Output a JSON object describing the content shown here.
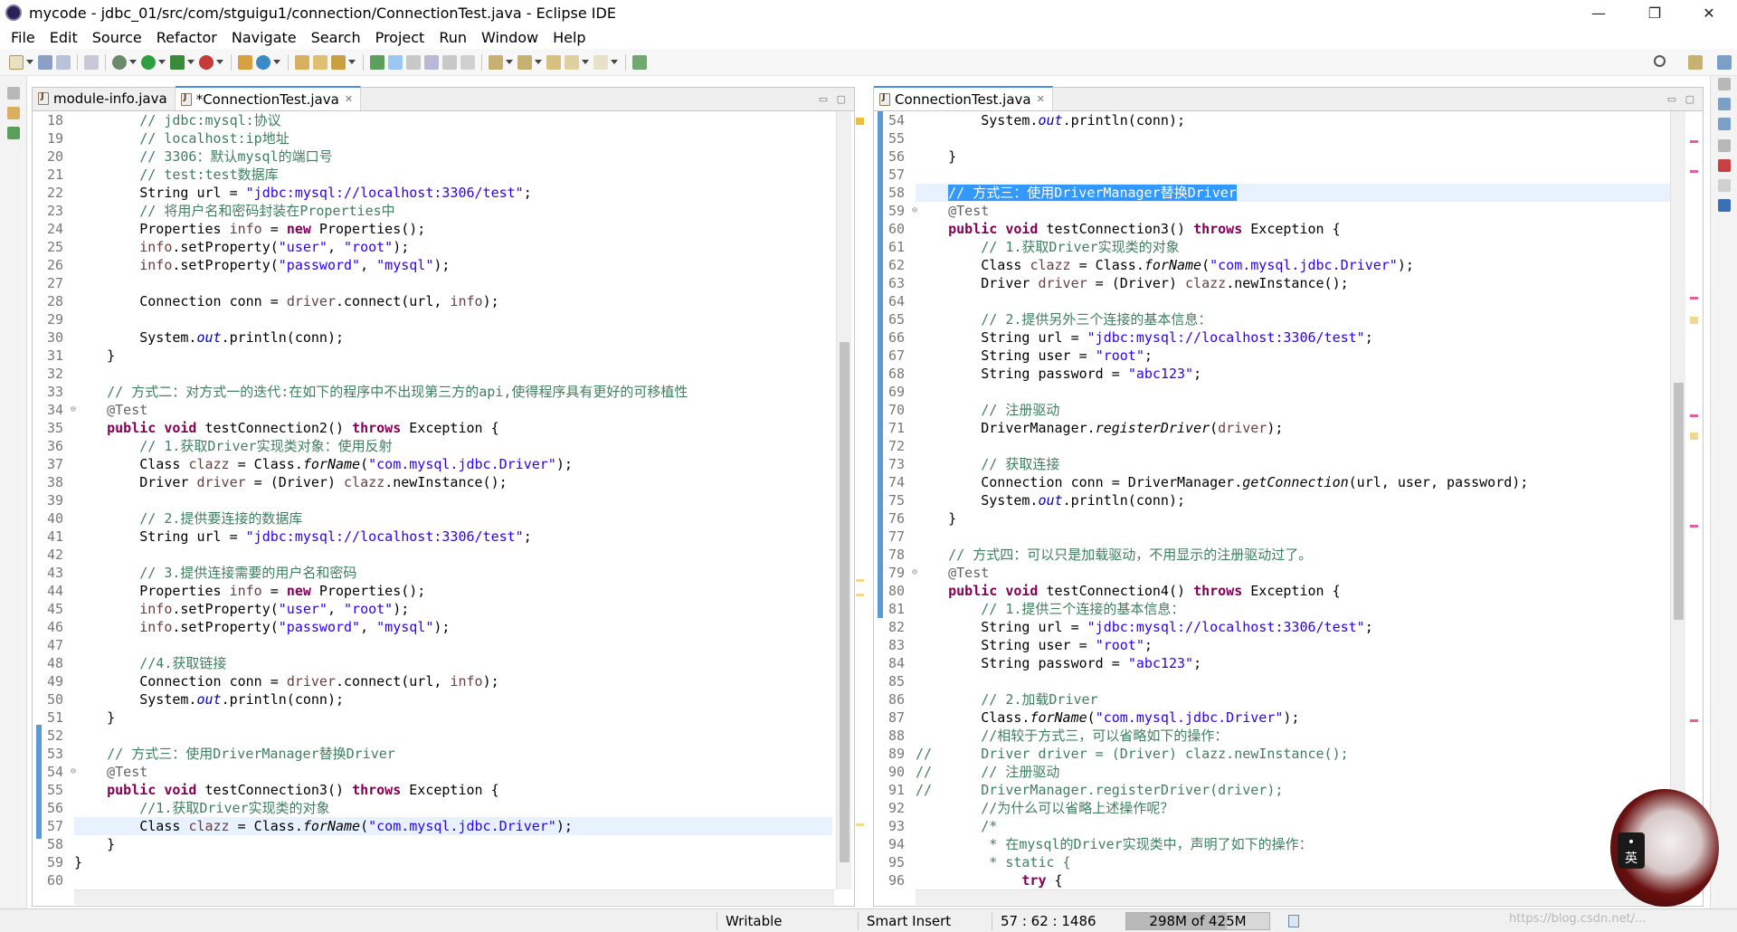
{
  "window": {
    "title": "mycode - jdbc_01/src/com/stguigu1/connection/ConnectionTest.java - Eclipse IDE",
    "controls": [
      "—",
      "❐",
      "✕"
    ]
  },
  "menu": [
    "File",
    "Edit",
    "Source",
    "Refactor",
    "Navigate",
    "Search",
    "Project",
    "Run",
    "Window",
    "Help"
  ],
  "left_editor": {
    "tabs": [
      {
        "label": "module-info.java",
        "active": false
      },
      {
        "label": "*ConnectionTest.java",
        "active": true
      }
    ],
    "line_numbers": [
      "18",
      "19",
      "20",
      "21",
      "22",
      "23",
      "24",
      "25",
      "26",
      "27",
      "28",
      "29",
      "30",
      "31",
      "32",
      "33",
      "34",
      "35",
      "36",
      "37",
      "38",
      "39",
      "40",
      "41",
      "42",
      "43",
      "44",
      "45",
      "46",
      "47",
      "48",
      "49",
      "50",
      "51",
      "52",
      "53",
      "54",
      "55",
      "56",
      "57",
      "58",
      "59",
      "60"
    ],
    "lines": [
      "        // jdbc:mysql:协议",
      "        // localhost:ip地址",
      "        // 3306：默认mysql的端口号",
      "        // test:test数据库",
      "        String url = \"jdbc:mysql://localhost:3306/test\";",
      "        // 将用户名和密码封装在Properties中",
      "        Properties info = new Properties();",
      "        info.setProperty(\"user\", \"root\");",
      "        info.setProperty(\"password\", \"mysql\");",
      "",
      "        Connection conn = driver.connect(url, info);",
      "",
      "        System.out.println(conn);",
      "    }",
      "",
      "    // 方式二：对方式一的迭代:在如下的程序中不出现第三方的api,使得程序具有更好的可移植性",
      "    @Test",
      "    public void testConnection2() throws Exception {",
      "        // 1.获取Driver实现类对象：使用反射",
      "        Class clazz = Class.forName(\"com.mysql.jdbc.Driver\");",
      "        Driver driver = (Driver) clazz.newInstance();",
      "",
      "        // 2.提供要连接的数据库",
      "        String url = \"jdbc:mysql://localhost:3306/test\";",
      "",
      "        // 3.提供连接需要的用户名和密码",
      "        Properties info = new Properties();",
      "        info.setProperty(\"user\", \"root\");",
      "        info.setProperty(\"password\", \"mysql\");",
      "",
      "        //4.获取链接",
      "        Connection conn = driver.connect(url, info);",
      "        System.out.println(conn);",
      "    }",
      "",
      "    // 方式三：使用DriverManager替换Driver",
      "    @Test",
      "    public void testConnection3() throws Exception {",
      "        //1.获取Driver实现类的对象",
      "        Class clazz = Class.forName(\"com.mysql.jdbc.Driver\");",
      "    }",
      "}",
      ""
    ]
  },
  "right_editor": {
    "tabs": [
      {
        "label": "ConnectionTest.java",
        "active": true
      }
    ],
    "line_numbers": [
      "54",
      "55",
      "56",
      "57",
      "58",
      "59",
      "60",
      "61",
      "62",
      "63",
      "64",
      "65",
      "66",
      "67",
      "68",
      "69",
      "70",
      "71",
      "72",
      "73",
      "74",
      "75",
      "76",
      "77",
      "78",
      "79",
      "80",
      "81",
      "82",
      "83",
      "84",
      "85",
      "86",
      "87",
      "88",
      "89",
      "90",
      "91",
      "92",
      "93",
      "94",
      "95",
      "96"
    ],
    "lines": [
      "        System.out.println(conn);",
      "",
      "    }",
      "",
      "    // 方式三：使用DriverManager替换Driver",
      "    @Test",
      "    public void testConnection3() throws Exception {",
      "        // 1.获取Driver实现类的对象",
      "        Class clazz = Class.forName(\"com.mysql.jdbc.Driver\");",
      "        Driver driver = (Driver) clazz.newInstance();",
      "",
      "        // 2.提供另外三个连接的基本信息：",
      "        String url = \"jdbc:mysql://localhost:3306/test\";",
      "        String user = \"root\";",
      "        String password = \"abc123\";",
      "",
      "        // 注册驱动",
      "        DriverManager.registerDriver(driver);",
      "",
      "        // 获取连接",
      "        Connection conn = DriverManager.getConnection(url, user, password);",
      "        System.out.println(conn);",
      "    }",
      "",
      "    // 方式四：可以只是加载驱动，不用显示的注册驱动过了。",
      "    @Test",
      "    public void testConnection4() throws Exception {",
      "        // 1.提供三个连接的基本信息：",
      "        String url = \"jdbc:mysql://localhost:3306/test\";",
      "        String user = \"root\";",
      "        String password = \"abc123\";",
      "",
      "        // 2.加载Driver",
      "        Class.forName(\"com.mysql.jdbc.Driver\");",
      "        //相较于方式三，可以省略如下的操作：",
      "//      Driver driver = (Driver) clazz.newInstance();",
      "//      // 注册驱动",
      "//      DriverManager.registerDriver(driver);",
      "        //为什么可以省略上述操作呢？",
      "        /*",
      "         * 在mysql的Driver实现类中，声明了如下的操作：",
      "         * static {",
      "             try {"
    ]
  },
  "status": {
    "writable": "Writable",
    "insert_mode": "Smart Insert",
    "position": "57 : 62 : 1486",
    "heap": "298M of 425M",
    "heap_used_fraction": 0.7
  },
  "avatar": {
    "badge_top": "•",
    "badge_text": "英"
  },
  "watermark": "https://blog.csdn.net/..."
}
